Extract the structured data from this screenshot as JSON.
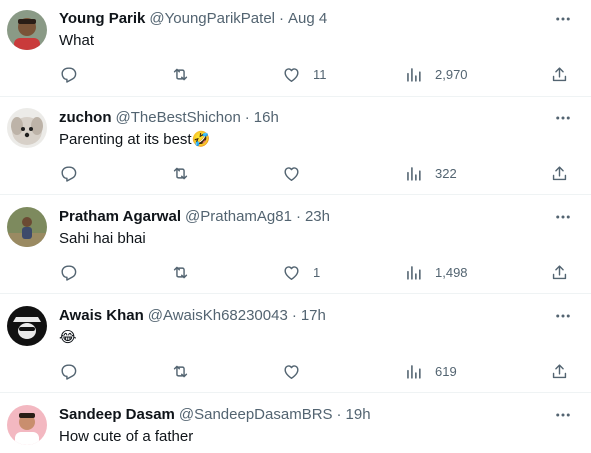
{
  "tweets": [
    {
      "name": "Young Parik",
      "handle": "@YoungParikPatel",
      "time": "Aug 4",
      "text": "What",
      "likes": "11",
      "views": "2,970",
      "avatar_color": "#6b5240"
    },
    {
      "name": "zuchon",
      "handle": "@TheBestShichon",
      "time": "16h",
      "text": "Parenting at its best",
      "emoji": "🤣",
      "likes": "",
      "views": "322",
      "avatar_color": "#d9d3cc"
    },
    {
      "name": "Pratham Agarwal",
      "handle": "@PrathamAg81",
      "time": "23h",
      "text": "Sahi hai bhai",
      "likes": "1",
      "views": "1,498",
      "avatar_color": "#6f7452"
    },
    {
      "name": "Awais Khan",
      "handle": "@AwaisKh68230043",
      "time": "17h",
      "text": "",
      "emoji": "😂",
      "likes": "",
      "views": "619",
      "avatar_color": "#111111"
    },
    {
      "name": "Sandeep Dasam",
      "handle": "@SandeepDasamBRS",
      "time": "19h",
      "text": "How cute of a father",
      "avatar_color": "#f0a9b4"
    }
  ],
  "colors": {
    "text": "#0f1419",
    "secondary": "#536471",
    "divider": "#eff3f4"
  },
  "icons": [
    "reply-icon",
    "retweet-icon",
    "like-icon",
    "views-icon",
    "share-icon",
    "more-icon"
  ]
}
